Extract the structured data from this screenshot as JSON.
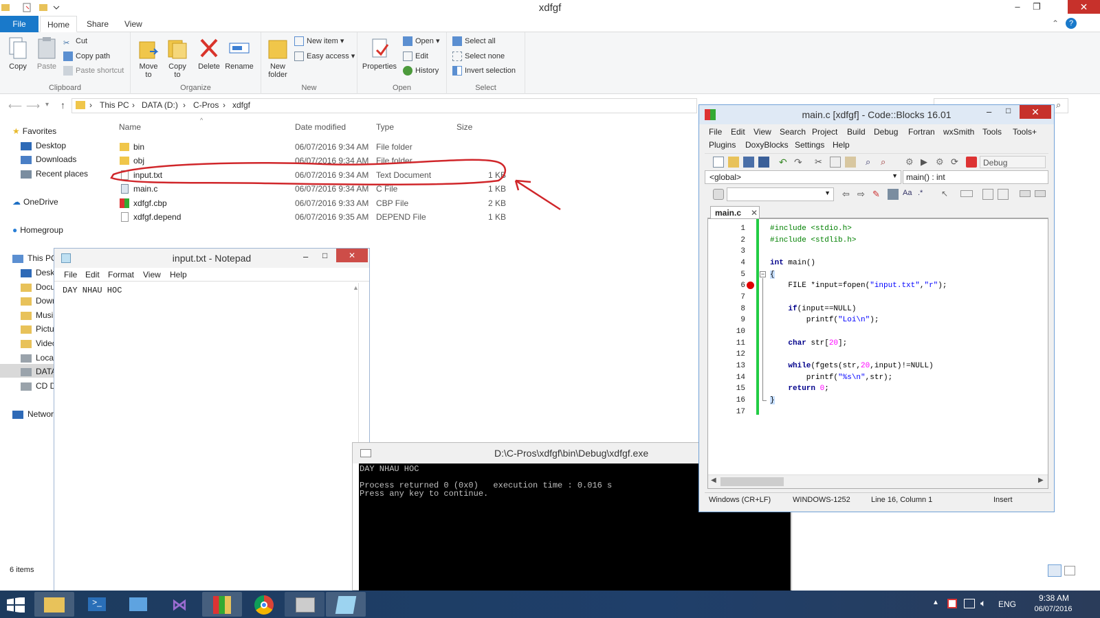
{
  "explorer": {
    "title": "xdfgf",
    "tabs": [
      "File",
      "Home",
      "Share",
      "View"
    ],
    "ribbon": {
      "clipboard": {
        "label": "Clipboard",
        "copy": "Copy",
        "paste": "Paste",
        "cut": "Cut",
        "copy_path": "Copy path",
        "paste_shortcut": "Paste shortcut"
      },
      "organize": {
        "label": "Organize",
        "move_to": "Move to",
        "copy_to": "Copy to",
        "delete": "Delete",
        "rename": "Rename"
      },
      "new": {
        "label": "New",
        "new_folder": "New folder",
        "new_item": "New item",
        "easy_access": "Easy access"
      },
      "open": {
        "label": "Open",
        "properties": "Properties",
        "open": "Open",
        "edit": "Edit",
        "history": "History"
      },
      "select": {
        "label": "Select",
        "select_all": "Select all",
        "select_none": "Select none",
        "invert_selection": "Invert selection"
      }
    },
    "breadcrumb": [
      "This PC",
      "DATA (D:)",
      "C-Pros",
      "xdfgf"
    ],
    "nav": {
      "favorites": "Favorites",
      "desktop": "Desktop",
      "downloads": "Downloads",
      "recent": "Recent places",
      "onedrive": "OneDrive",
      "homegroup": "Homegroup",
      "thispc": "This PC",
      "pc_items": [
        "Deskt",
        "Docu",
        "Down",
        "Musi",
        "Pictu",
        "Videc",
        "Local",
        "DATA",
        "CD D"
      ],
      "network": "Networ"
    },
    "columns": {
      "name": "Name",
      "date": "Date modified",
      "type": "Type",
      "size": "Size"
    },
    "files": [
      {
        "name": "bin",
        "date": "06/07/2016 9:34 AM",
        "type": "File folder",
        "size": ""
      },
      {
        "name": "obj",
        "date": "06/07/2016 9:34 AM",
        "type": "File folder",
        "size": ""
      },
      {
        "name": "input.txt",
        "date": "06/07/2016 9:34 AM",
        "type": "Text Document",
        "size": "1 KB"
      },
      {
        "name": "main.c",
        "date": "06/07/2016 9:34 AM",
        "type": "C File",
        "size": "1 KB"
      },
      {
        "name": "xdfgf.cbp",
        "date": "06/07/2016 9:33 AM",
        "type": "CBP File",
        "size": "2 KB"
      },
      {
        "name": "xdfgf.depend",
        "date": "06/07/2016 9:35 AM",
        "type": "DEPEND File",
        "size": "1 KB"
      }
    ],
    "status": "6 items"
  },
  "notepad": {
    "title": "input.txt - Notepad",
    "menu": [
      "File",
      "Edit",
      "Format",
      "View",
      "Help"
    ],
    "content": "DAY NHAU HOC"
  },
  "console": {
    "title": "D:\\C-Pros\\xdfgf\\bin\\Debug\\xdfgf.exe",
    "lines": [
      "DAY NHAU HOC",
      "",
      "Process returned 0 (0x0)   execution time : 0.016 s",
      "Press any key to continue."
    ]
  },
  "codeblocks": {
    "title": "main.c [xdfgf] - Code::Blocks 16.01",
    "menu_row1": [
      "File",
      "Edit",
      "View",
      "Search",
      "Project",
      "Build",
      "Debug",
      "Fortran",
      "wxSmith",
      "Tools",
      "Tools+"
    ],
    "menu_row2": [
      "Plugins",
      "DoxyBlocks",
      "Settings",
      "Help"
    ],
    "build_target": "Debug",
    "scope": "<global>",
    "function": "main() : int",
    "tab": "main.c",
    "line_numbers": [
      "1",
      "2",
      "3",
      "4",
      "5",
      "6",
      "7",
      "8",
      "9",
      "10",
      "11",
      "12",
      "13",
      "14",
      "15",
      "16",
      "17"
    ],
    "status": {
      "eol": "Windows (CR+LF)",
      "encoding": "WINDOWS-1252",
      "position": "Line 16, Column 1",
      "mode": "Insert"
    }
  },
  "taskbar": {
    "lang": "ENG",
    "time": "9:38 AM",
    "date": "06/07/2016"
  },
  "colors": {
    "accent": "#1979ca",
    "close": "#c7312b",
    "annotation": "#d0262a",
    "breakpoint": "#e00000",
    "changebar": "#22cc44"
  }
}
